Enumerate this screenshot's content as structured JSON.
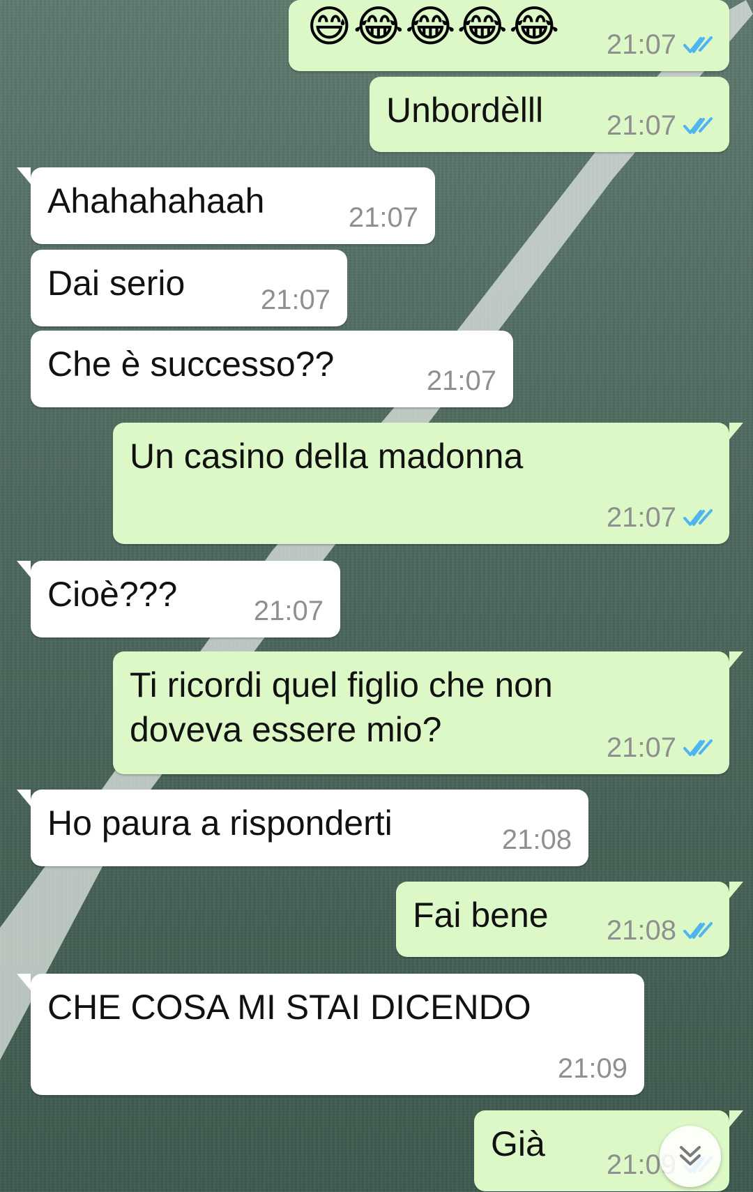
{
  "conversation": {
    "messages": [
      {
        "text": "😅😂😂😂😂",
        "time": "21:07"
      },
      {
        "text": "Unbordèlll",
        "time": "21:07"
      },
      {
        "text": "Ahahahahaah",
        "time": "21:07"
      },
      {
        "text": "Dai serio",
        "time": "21:07"
      },
      {
        "text": "Che è successo??",
        "time": "21:07"
      },
      {
        "text": "Un casino della madonna",
        "time": "21:07"
      },
      {
        "text": "Cioè???",
        "time": "21:07"
      },
      {
        "text": "Ti ricordi quel figlio che non\ndoveva essere mio?",
        "time": "21:07"
      },
      {
        "text": "Ho paura a risponderti",
        "time": "21:08"
      },
      {
        "text": "Fai bene",
        "time": "21:08"
      },
      {
        "text": "CHE COSA MI STAI DICENDO",
        "time": "21:09"
      },
      {
        "text": "Già",
        "time": "21:09"
      }
    ]
  },
  "colors": {
    "incoming_bubble": "#ffffff",
    "outgoing_bubble": "#dcf8c6",
    "read_ticks": "#4fb4ef",
    "timestamp": "#8f8f8f"
  },
  "icons": {
    "read_receipt": "double-check-icon",
    "scroll_down": "double-chevron-down-icon"
  }
}
